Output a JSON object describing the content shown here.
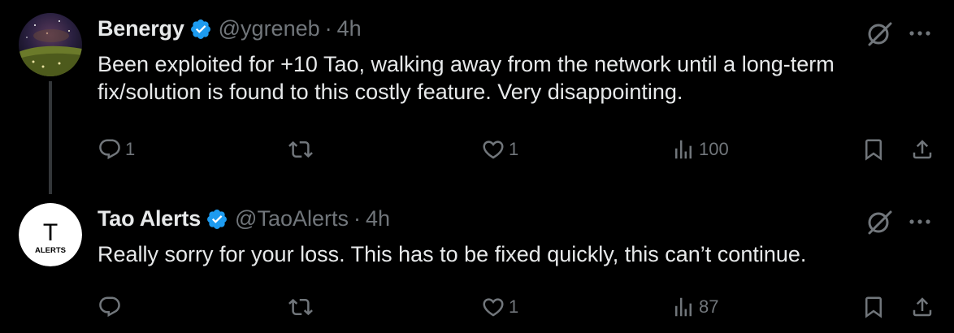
{
  "tweets": [
    {
      "name": "Benergy",
      "handle": "@ygreneb",
      "separator": "·",
      "time": "4h",
      "text": "Been exploited for +10 Tao, walking away from the network until a long-term fix/solution is found to this costly feature. Very disappointing.",
      "replies": "1",
      "retweets": "",
      "likes": "1",
      "views": "100"
    },
    {
      "name": "Tao Alerts",
      "handle": "@TaoAlerts",
      "separator": "·",
      "time": "4h",
      "text": "Really sorry for your loss. This has to be fixed quickly, this can’t continue.",
      "replies": "",
      "retweets": "",
      "likes": "1",
      "views": "87",
      "avatar_letter": "T",
      "avatar_word": "ALERTS"
    }
  ],
  "colors": {
    "background": "#000000",
    "text": "#e7e9ea",
    "muted": "#71767b",
    "verified": "#1d9bf0"
  },
  "icons": [
    "verified-badge-icon",
    "grok-icon",
    "more-icon",
    "reply-icon",
    "retweet-icon",
    "like-icon",
    "views-icon",
    "bookmark-icon",
    "share-icon"
  ]
}
